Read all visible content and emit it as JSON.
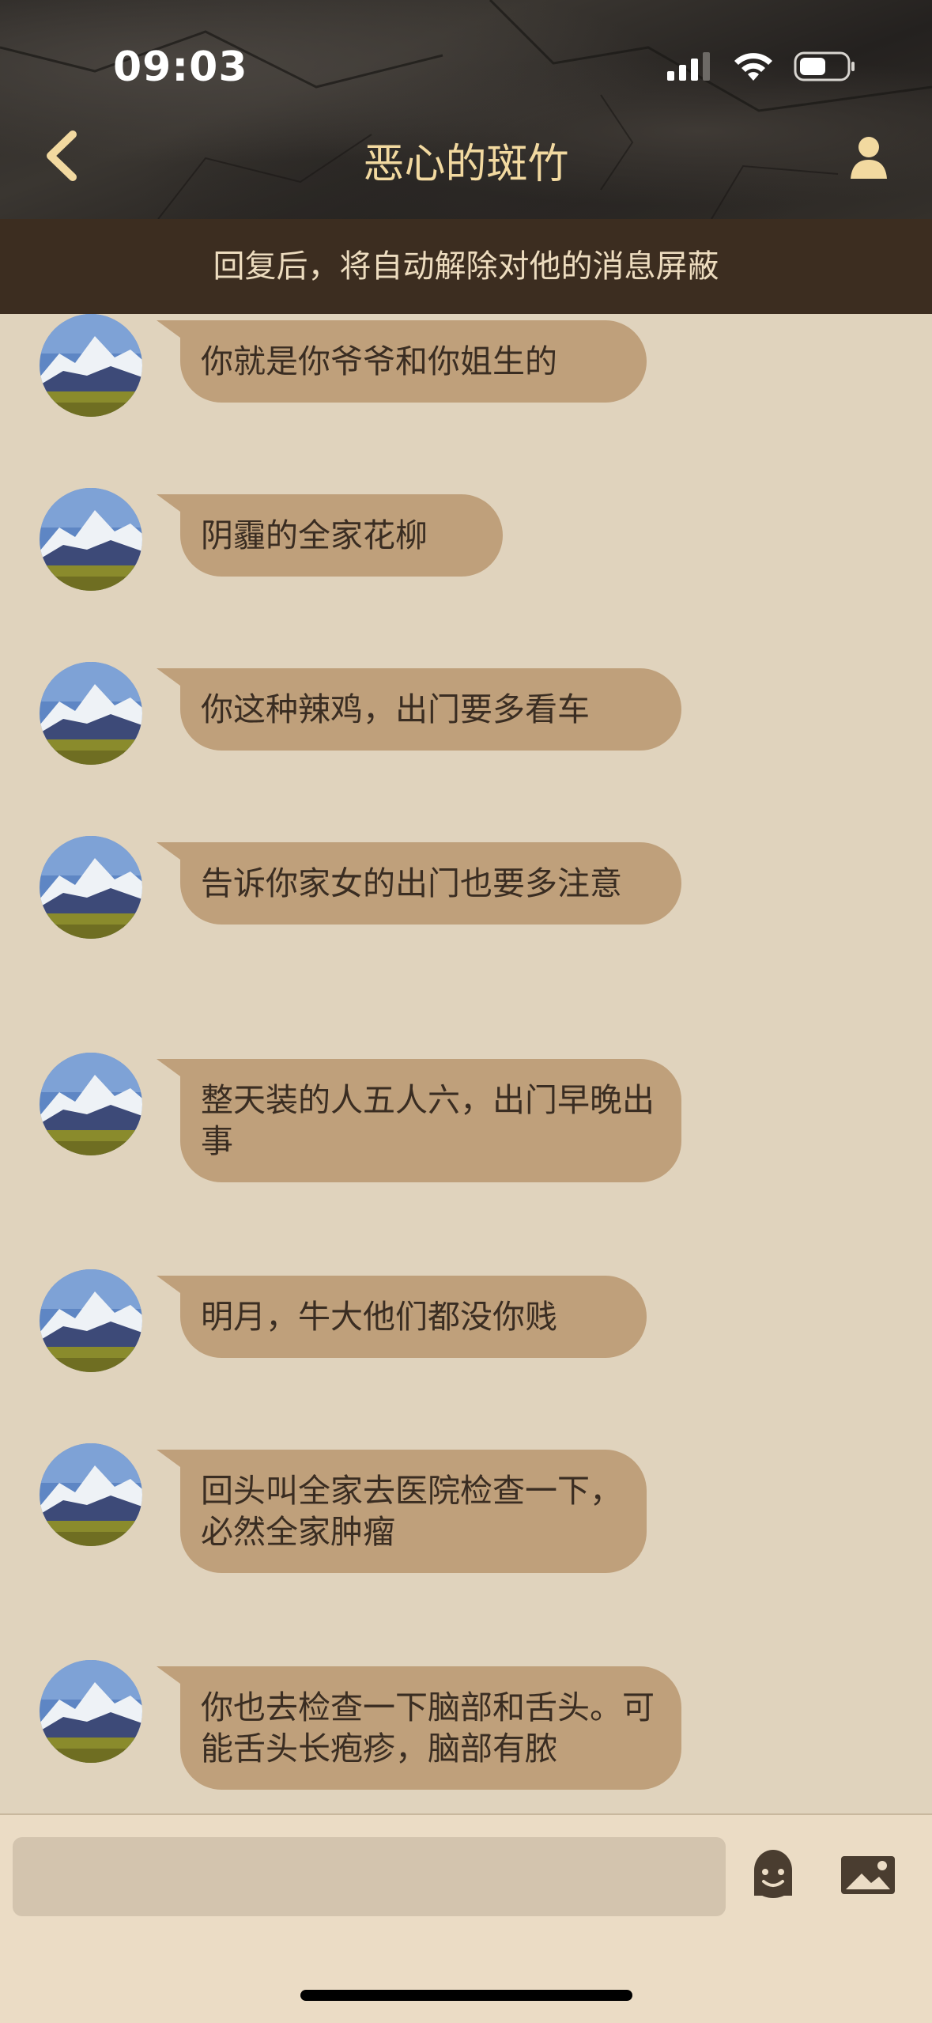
{
  "status": {
    "time": "09:03"
  },
  "nav": {
    "title": "恶心的斑竹"
  },
  "notice": "回复后，将自动解除对他的消息屏蔽",
  "messages": [
    "你就是你爷爷和你姐生的",
    "阴霾的全家花柳",
    "你这种辣鸡，出门要多看车",
    "告诉你家女的出门也要多注意",
    "整天装的人五人六，出门早晚出事",
    "明月，牛大他们都没你贱",
    "回头叫全家去医院检查一下，必然全家肿瘤",
    "你也去检查一下脑部和舌头。可能舌头长疱疹，脑部有脓"
  ],
  "colors": {
    "header_title": "#f2d9a0",
    "notice_bg": "#3c2d20",
    "chat_bg": "#e0d3bd",
    "bubble_bg": "#bfa07b",
    "bubble_text": "#3a2d22"
  },
  "icons": {
    "back": "chevron-left-icon",
    "profile": "person-icon",
    "emoji": "emoji-face-icon",
    "image": "image-icon"
  },
  "composer": {
    "value": ""
  }
}
